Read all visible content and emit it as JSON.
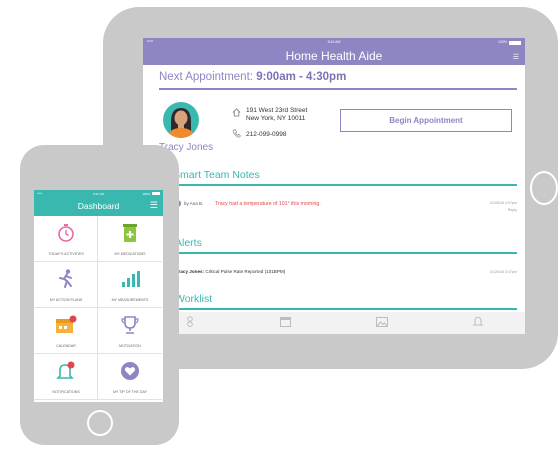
{
  "tablet": {
    "status_left": "•••••",
    "status_time": "9:41 AM",
    "status_battery": "100%",
    "title": "Home Health Aide",
    "next_label": "Next Appointment:",
    "next_time": "9:00am - 4:30pm",
    "patient_name": "Tracy Jones",
    "address_line1": "191 West 23rd Street",
    "address_line2": "New York, NY 10011",
    "phone": "212-099-0998",
    "begin_button": "Begin Appointment",
    "notes_title": "Smart Team Notes",
    "note_by": "by Ana B.",
    "note_text": "Tracy had a temperature of 101° this morning.",
    "note_time": "01/25/16 4:07pm",
    "note_reply": "Reply",
    "alerts_title": "Alerts",
    "alert_name": "Tracy Jones:",
    "alert_text": "Critical Pulse Rate Reported (101BPM)",
    "alert_time": "01/25/16 3:47pm",
    "worklist_title": "Worklist"
  },
  "phone": {
    "status_left": "•••••",
    "status_time": "9:41 AM",
    "status_battery": "100%",
    "title": "Dashboard",
    "tiles": [
      {
        "label": "TODAY'S ACTIVITIES",
        "icon": "clock-icon"
      },
      {
        "label": "MY MEDICATIONS",
        "icon": "pill-bottle-icon"
      },
      {
        "label": "MY ACTION PLANS",
        "icon": "running-person-icon"
      },
      {
        "label": "MY MEASUREMENTS",
        "icon": "bar-chart-icon"
      },
      {
        "label": "CALENDAR",
        "icon": "calendar-icon"
      },
      {
        "label": "MOTIVATION",
        "icon": "trophy-icon"
      },
      {
        "label": "NOTIFICATIONS",
        "icon": "bell-icon"
      },
      {
        "label": "MY TIP OF THE DAY",
        "icon": "heart-icon"
      }
    ]
  },
  "colors": {
    "purple": "#8e86c2",
    "teal": "#39b8b0",
    "alert_red": "#e0474c",
    "device_gray": "#c9c9c9"
  }
}
